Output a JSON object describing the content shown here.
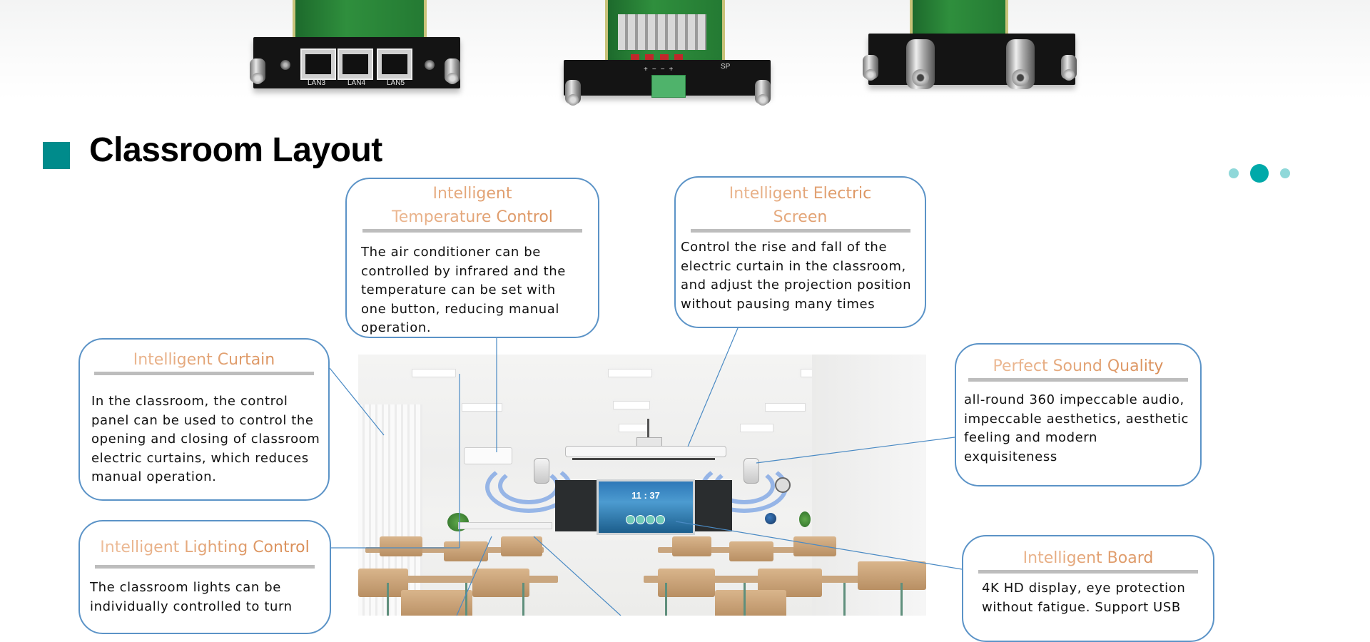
{
  "products": [
    {
      "name": "network-module",
      "ports": [
        "LAN3",
        "LAN4",
        "LAN5"
      ]
    },
    {
      "name": "speaker-amplifier-module",
      "terminal_marks": [
        "+",
        "−",
        "−",
        "+"
      ],
      "label": "SP"
    },
    {
      "name": "bnc-video-module",
      "connectors": 2
    }
  ],
  "section": {
    "title": "Classroom Layout",
    "marker_color": "#008b8b"
  },
  "pager": {
    "count": 3,
    "active_index": 1,
    "active_color": "#00a9a9",
    "inactive_color": "#8fd8d9"
  },
  "photo": {
    "board_time": "11 : 37"
  },
  "callouts": {
    "temperature": {
      "title": "Intelligent\nTemperature Control",
      "body": "The air conditioner can be\ncontrolled by infrared and the\ntemperature can be set with\none button, reducing manual\noperation."
    },
    "screen": {
      "title": "Intelligent Electric\nScreen",
      "body": "Control the rise and fall of the\nelectric curtain in the classroom,\nand adjust the projection position\nwithout pausing many times"
    },
    "curtain": {
      "title": "Intelligent Curtain",
      "body": "In the classroom, the control\npanel can be used to control the\nopening and closing of classroom\nelectric curtains, which reduces\nmanual operation."
    },
    "lighting": {
      "title": "Intelligent Lighting Control",
      "body": "The classroom lights can be\nindividually controlled to turn"
    },
    "sound": {
      "title": "Perfect Sound Quality",
      "body": "all-round 360 impeccable audio,\nimpeccable aesthetics, aesthetic\nfeeling and modern\nexquisiteness"
    },
    "board": {
      "title": "Intelligent Board",
      "body": "4K HD display, eye protection\nwithout fatigue. Support USB"
    }
  },
  "colors": {
    "callout_border": "#5b93c7",
    "title_orange": "#d6864c",
    "connector": "#4a8ac4"
  }
}
